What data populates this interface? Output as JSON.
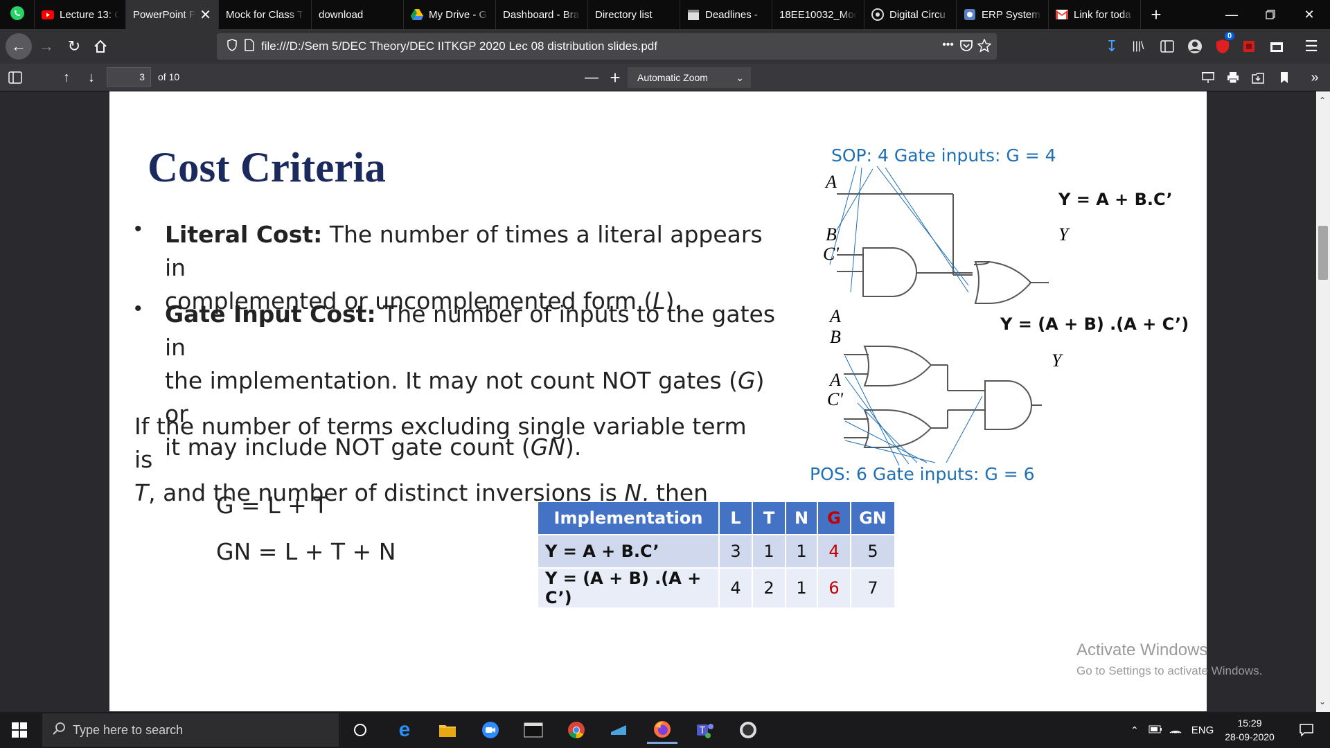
{
  "browser": {
    "tabs": [
      {
        "title": "Lecture 13: C",
        "icon": "youtube-icon",
        "active": false
      },
      {
        "title": "PowerPoint P",
        "icon": "none",
        "active": true
      },
      {
        "title": "Mock for Class T",
        "icon": "none",
        "active": false
      },
      {
        "title": "download",
        "icon": "none",
        "active": false
      },
      {
        "title": "My Drive - G",
        "icon": "google-drive-icon",
        "active": false
      },
      {
        "title": "Dashboard - Bra",
        "icon": "none",
        "active": false
      },
      {
        "title": "Directory list",
        "icon": "none",
        "active": false
      },
      {
        "title": "Deadlines -",
        "icon": "calendar-icon",
        "active": false
      },
      {
        "title": "18EE10032_Moc",
        "icon": "none",
        "active": false
      },
      {
        "title": "Digital Circu",
        "icon": "gear-circle-icon",
        "active": false
      },
      {
        "title": "ERP System",
        "icon": "erp-logo-icon",
        "active": false
      },
      {
        "title": "Link for toda",
        "icon": "gmail-icon",
        "active": false
      }
    ],
    "new_tab_label": "+",
    "url": "file:///D:/Sem 5/DEC Theory/DEC IITKGP 2020 Lec 08 distribution slides.pdf",
    "url_more": "•••",
    "notification_badge": "0"
  },
  "pdf_toolbar": {
    "page_number": "3",
    "page_count": "of 10",
    "zoom": "Automatic Zoom",
    "zoom_out": "—",
    "zoom_in": "+"
  },
  "slide": {
    "title": "Cost Criteria",
    "bullet1_bold": "Literal Cost:",
    "bullet1_text_a": " The number of times a literal appears in",
    "bullet1_text_b": "complemented or uncomplemented form (",
    "bullet1_var": "L",
    "bullet1_end": ").",
    "bullet2_bold": "Gate Input Cost:",
    "bullet2_text_a": " The number of inputs to the gates in",
    "bullet2_text_b": "the implementation. It may not count NOT gates (",
    "bullet2_var_g": "G",
    "bullet2_text_c": ") or",
    "bullet2_text_d": "it may include NOT gate count (",
    "bullet2_var_gn": "GN",
    "bullet2_end": ").",
    "para_line1": "If the number of terms excluding single variable term is",
    "para_var_t": "T",
    "para_line2_mid": ", and the number of distinct inversions is ",
    "para_var_n": "N",
    "para_line2_end": ", then",
    "eq1": "G = L + T",
    "eq2": "GN = L + T + N",
    "sop_caption": "SOP: 4 Gate inputs: G = 4",
    "sop_expr": "Y = A + B.C’",
    "pos_caption": "POS: 6 Gate inputs: G = 6",
    "pos_expr": "Y = (A + B) .(A + C’)",
    "labels": {
      "sop_a": "A",
      "sop_b": "B",
      "sop_c": "C'",
      "sop_y": "Y",
      "pos_a1": "A",
      "pos_b": "B",
      "pos_a2": "A",
      "pos_c": "C'",
      "pos_y": "Y"
    },
    "table": {
      "headers": [
        "Implementation",
        "L",
        "T",
        "N",
        "G",
        "GN"
      ],
      "rows": [
        [
          "Y = A + B.C’",
          "3",
          "1",
          "1",
          "4",
          "5"
        ],
        [
          "Y = (A + B) .(A + C’)",
          "4",
          "2",
          "1",
          "6",
          "7"
        ]
      ]
    },
    "watermark_line1": "Activate Windows",
    "watermark_line2": "Go to Settings to activate Windows."
  },
  "taskbar": {
    "search_placeholder": "Type here to search",
    "lang": "ENG",
    "time": "15:29",
    "date": "28-09-2020"
  }
}
